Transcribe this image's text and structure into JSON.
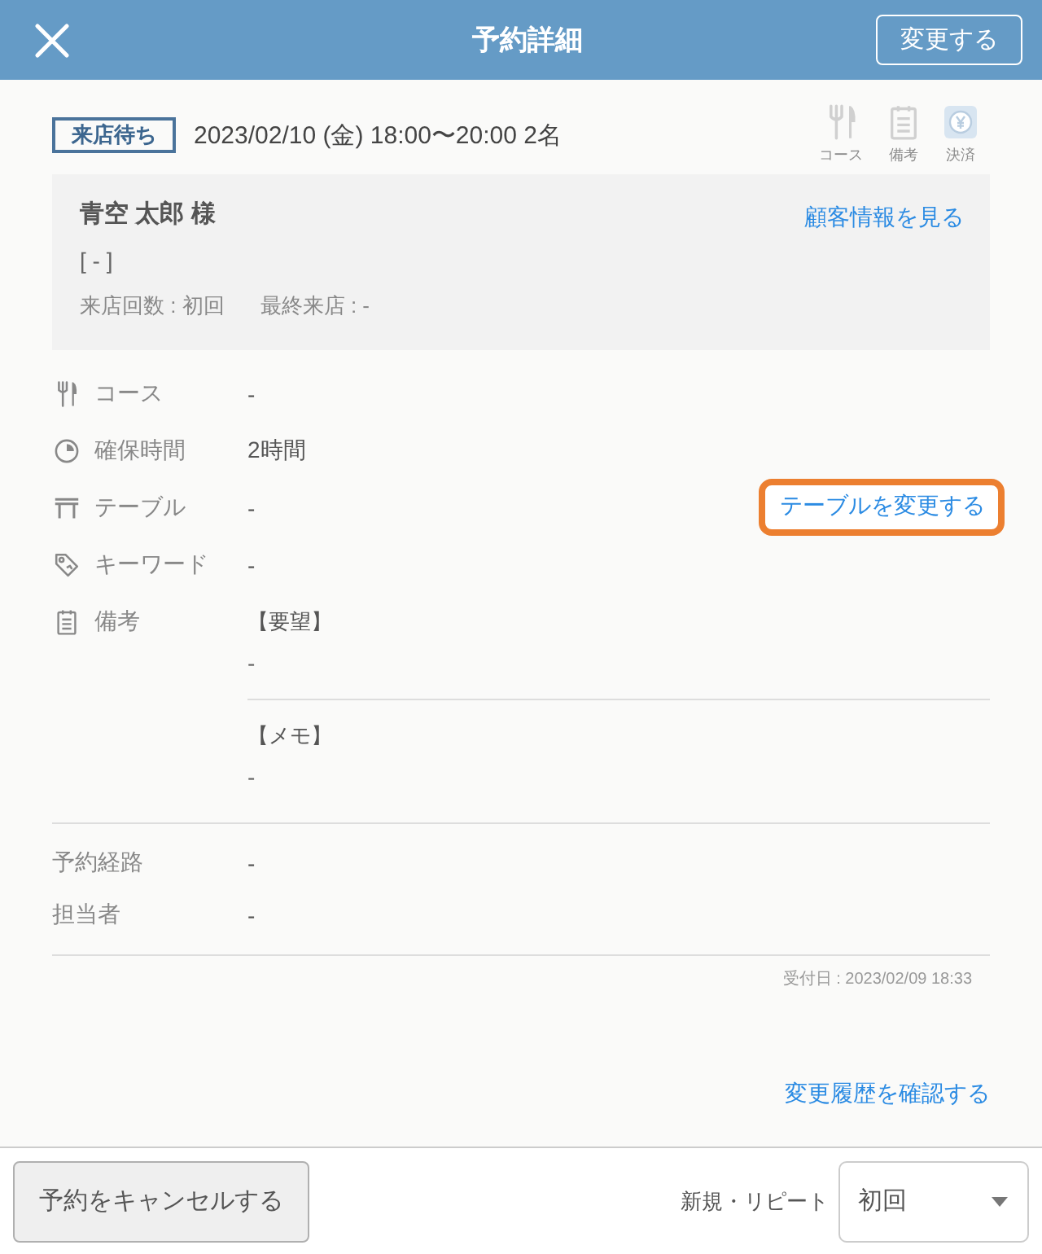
{
  "header": {
    "title": "予約詳細",
    "edit_button": "変更する"
  },
  "summary": {
    "status": "来店待ち",
    "datetime": "2023/02/10 (金) 18:00〜20:00 2名",
    "icons": [
      {
        "kind": "course",
        "label": "コース"
      },
      {
        "kind": "memo",
        "label": "備考"
      },
      {
        "kind": "payment",
        "label": "決済"
      }
    ]
  },
  "customer": {
    "name": "青空 太郎 様",
    "tag": "[ - ]",
    "visits": "来店回数 : 初回",
    "last_visit": "最終来店 : -",
    "link": "顧客情報を見る"
  },
  "details": [
    {
      "kind": "course",
      "label": "コース",
      "value": "-"
    },
    {
      "kind": "duration",
      "label": "確保時間",
      "value": "2時間"
    },
    {
      "kind": "table",
      "label": "テーブル",
      "value": "-",
      "action": {
        "label": "テーブルを変更する",
        "highlighted": true
      }
    },
    {
      "kind": "keyword",
      "label": "キーワード",
      "value": "-"
    },
    {
      "kind": "memo",
      "label": "備考",
      "notes": [
        {
          "heading": "【要望】",
          "text": "-"
        },
        {
          "heading": "【メモ】",
          "text": "-"
        }
      ]
    }
  ],
  "extra": [
    {
      "label": "予約経路",
      "value": "-"
    },
    {
      "label": "担当者",
      "value": "-"
    }
  ],
  "received": "受付日 : 2023/02/09 18:33",
  "history_link": "変更履歴を確認する",
  "footer": {
    "cancel_button": "予約をキャンセルする",
    "type_label": "新規・リピート",
    "type_select": {
      "value": "初回"
    }
  }
}
